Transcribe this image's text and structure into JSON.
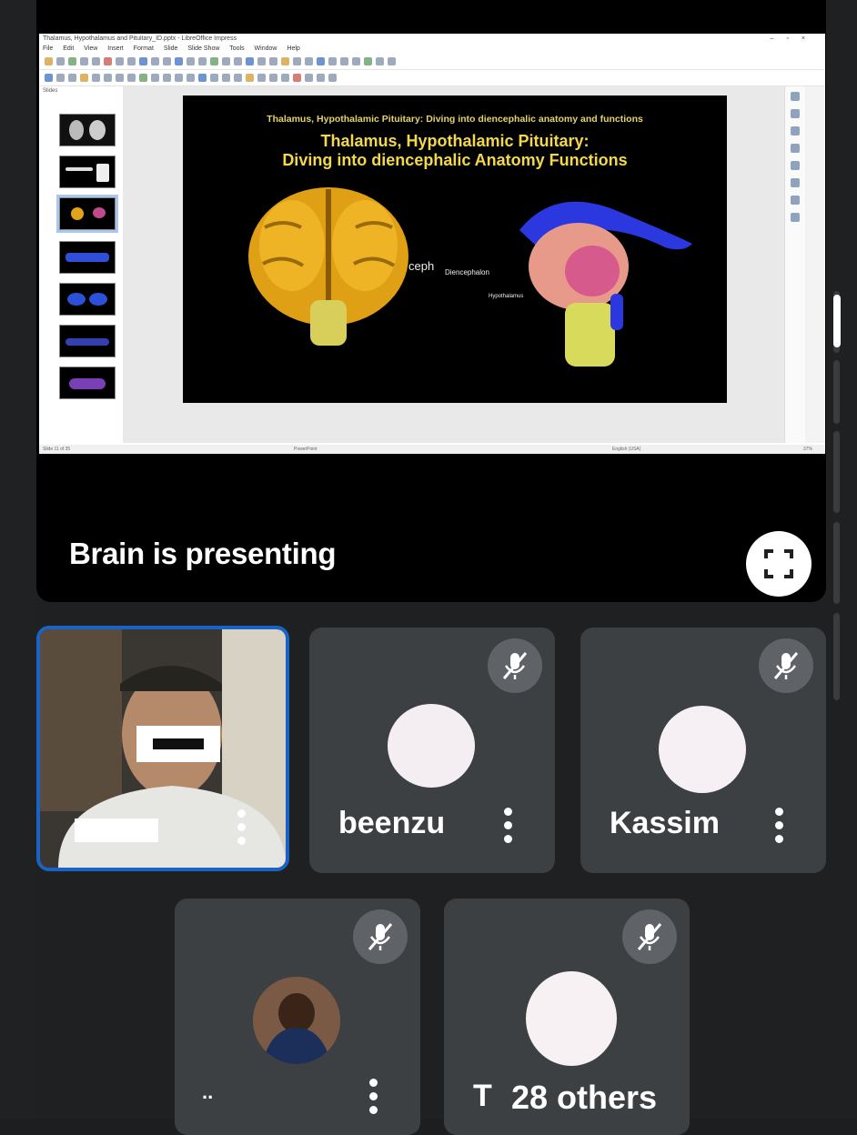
{
  "presentation": {
    "window_title": "Thalamus, Hypothalamus and Pituitary_ID.pptx - LibreOffice Impress",
    "menu": [
      "File",
      "Edit",
      "View",
      "Insert",
      "Format",
      "Slide",
      "Slide Show",
      "Tools",
      "Window",
      "Help"
    ],
    "slides_panel_label": "Slides",
    "slide": {
      "subtitle": "Thalamus, Hypothalamic Pituitary: Diving into diencephalic anatomy and functions",
      "title_line1": "Thalamus, Hypothalamic Pituitary:",
      "title_line2": "Diving into diencephalic  Anatomy Functions",
      "label_ceph": "ceph",
      "label_diencephalon": "Diencephalon",
      "label_hypothalamus": "Hypothalamus"
    },
    "status": {
      "slide_counter": "Slide 11 of 35",
      "layout": "PowerPoint",
      "language": "English (USA)",
      "zoom": "37%"
    }
  },
  "presenting_label": "Brain is presenting",
  "participants": [
    {
      "name": "beenzu",
      "muted": true
    },
    {
      "name": "Kassim",
      "muted": true
    },
    {
      "name": "..",
      "muted": true
    },
    {
      "name": "T",
      "muted": true
    }
  ],
  "others_count_label": "28 others",
  "icons": {
    "fullscreen": "fullscreen-icon",
    "mute": "mic-off-icon",
    "more": "more-vert-icon"
  },
  "colors": {
    "self_border": "#1a63c6",
    "tile_bg": "#3c4043",
    "mute_badge": "#5f6368",
    "slide_title": "#f2d84a"
  }
}
